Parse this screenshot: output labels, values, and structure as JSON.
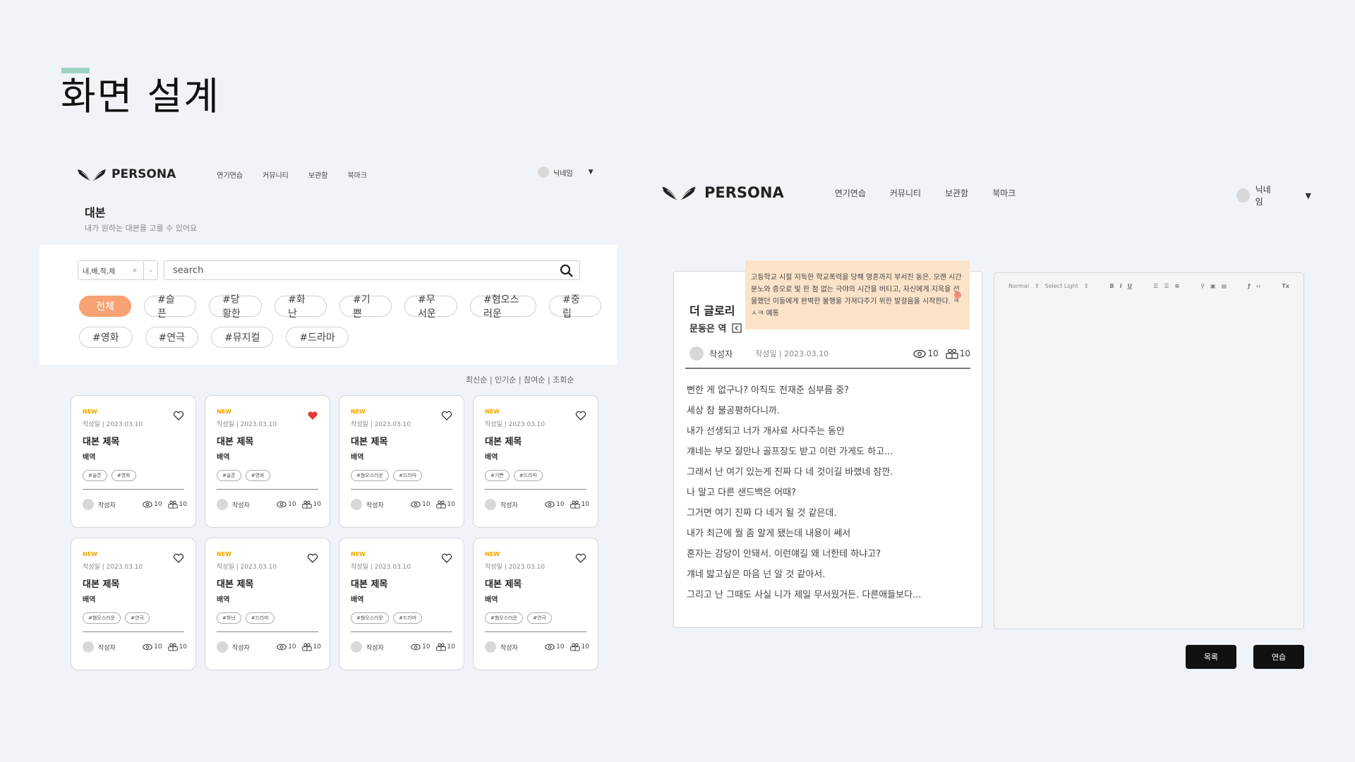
{
  "slide": {
    "title": "화면 설계"
  },
  "brand": {
    "name": "PERSONA"
  },
  "nav": {
    "items": [
      "연기연습",
      "커뮤니티",
      "보관함",
      "북마크"
    ],
    "user": "닉네임"
  },
  "list_page": {
    "title": "대본",
    "subtitle": "내가 원하는 대본을 고를 수 있어요",
    "select_value": "내,배,작,제",
    "search_placeholder": "search",
    "tags_row1": [
      "전체",
      "#슬픈",
      "#당황한",
      "#화난",
      "#기쁜",
      "#무서운",
      "#혐오스러운",
      "#중립"
    ],
    "tags_row2": [
      "#영화",
      "#연극",
      "#뮤지컬",
      "#드라마"
    ],
    "sort": "최신순 | 인기순 | 참여순 | 조회순",
    "cards": [
      {
        "badge": "NEW",
        "date": "작성일 | 2023.03.10",
        "title": "대본 제목",
        "role": "배역",
        "tags": [
          "#슬픈",
          "#영화"
        ],
        "author": "작성자",
        "views": "10",
        "uses": "10",
        "liked": false
      },
      {
        "badge": "NEW",
        "date": "작성일 | 2023.03.10",
        "title": "대본 제목",
        "role": "배역",
        "tags": [
          "#슬픈",
          "#영화"
        ],
        "author": "작성자",
        "views": "10",
        "uses": "10",
        "liked": true
      },
      {
        "badge": "NEW",
        "date": "작성일 | 2023.03.10",
        "title": "대본 제목",
        "role": "배역",
        "tags": [
          "#혐오스러운",
          "#드라마"
        ],
        "author": "작성자",
        "views": "10",
        "uses": "10",
        "liked": false
      },
      {
        "badge": "NEW",
        "date": "작성일 | 2023.03.10",
        "title": "대본 제목",
        "role": "배역",
        "tags": [
          "#기쁜",
          "#드라마"
        ],
        "author": "작성자",
        "views": "10",
        "uses": "10",
        "liked": false
      },
      {
        "badge": "NEW",
        "date": "작성일 | 2023.03.10",
        "title": "대본 제목",
        "role": "배역",
        "tags": [
          "#혐오스러운",
          "#연극"
        ],
        "author": "작성자",
        "views": "10",
        "uses": "10",
        "liked": false
      },
      {
        "badge": "NEW",
        "date": "작성일 | 2023.03.10",
        "title": "대본 제목",
        "role": "배역",
        "tags": [
          "#화난",
          "#드라마"
        ],
        "author": "작성자",
        "views": "10",
        "uses": "10",
        "liked": false
      },
      {
        "badge": "NEW",
        "date": "작성일 | 2023.03.10",
        "title": "대본 제목",
        "role": "배역",
        "tags": [
          "#혐오스러운",
          "#드라마"
        ],
        "author": "작성자",
        "views": "10",
        "uses": "10",
        "liked": false
      },
      {
        "badge": "NEW",
        "date": "작성일 | 2023.03.10",
        "title": "대본 제목",
        "role": "배역",
        "tags": [
          "#혐오스러운",
          "#연극"
        ],
        "author": "작성자",
        "views": "10",
        "uses": "10",
        "liked": false
      }
    ]
  },
  "detail_page": {
    "title": "더 글로리",
    "role": "문동은 역",
    "synopsis": "고등학교 시절 지독한 학교폭력을 당해 영혼까지 부서진 동은. 오랜 시간 분노와 증오로 빛 한 점 없는 극야의 시간을 버티고, 자신에게 지옥을 선물했던 이들에게 완벽한 불행을 가져다주기 위한 발걸음을 시작한다. ㅋㅅㅋ 예통",
    "author": "작성자",
    "date": "작성일 | 2023.03.10",
    "views": "10",
    "uses": "10",
    "lines": [
      "뻔한 게 없구나? 아직도 전재준 심부름 중?",
      "세상 참   불공평하다니까.",
      "내가 선생되고 너가 개사료 사다주는 동안",
      "걔네는 부모 잘만나 골프장도 받고 이런 가게도 하고...",
      "그래서 난 여기 있는게 진짜 다 네 것이길 바랬네 잠깐.",
      "나 말고 다른 샌드백은 어때?",
      "그거면 여기 진짜 다 네거 될 것 같은데.",
      "내가 최근에 뭘 좀 알게 됐는데 내용이 쎄서",
      "혼자는 감당이 안돼서. 이런얘길 왜 너한테 하냐고?",
      "걔네 밟고싶은 마음 넌 알 것 같아서.",
      "그리고 난 그때도 사실 니가 제일 무서웠거든. 다른애들보다..."
    ],
    "editor_toolbar": [
      "Normal",
      "Select Light"
    ],
    "buttons": {
      "list": "목록",
      "practice": "연습"
    }
  }
}
